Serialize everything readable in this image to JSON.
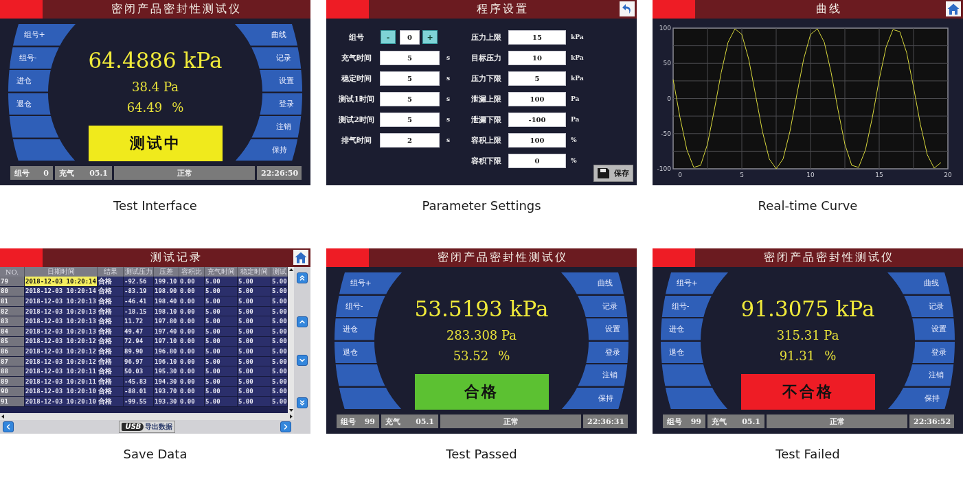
{
  "screens": [
    {
      "kind": "test",
      "title": "密闭产品密封性测试仪",
      "left_buttons": [
        "组号+",
        "组号-",
        "进仓",
        "退仓"
      ],
      "right_buttons": [
        "曲线",
        "记录",
        "设置",
        "登录",
        "注销",
        "保持"
      ],
      "pressure": "64.4886 kPa",
      "difference": "38.4 Pa",
      "ratio": "64.49",
      "ratio_unit": "%",
      "result": {
        "label": "测试中",
        "color": "#f0ea1c"
      },
      "status_bar": {
        "group_label": "组号",
        "group": "0",
        "fill_label": "充气",
        "fill": "05.1",
        "state": "正常",
        "time": "22:26:50"
      },
      "caption": "Test Interface"
    },
    {
      "kind": "settings",
      "title": "程序设置",
      "group": {
        "label": "组号",
        "minus": "-",
        "value": "0",
        "plus": "+"
      },
      "left_fields": [
        {
          "label": "充气时间",
          "value": "5",
          "unit": "s"
        },
        {
          "label": "稳定时间",
          "value": "5",
          "unit": "s"
        },
        {
          "label": "测试1时间",
          "value": "5",
          "unit": "s"
        },
        {
          "label": "测试2时间",
          "value": "5",
          "unit": "s"
        },
        {
          "label": "排气时间",
          "value": "2",
          "unit": "s"
        }
      ],
      "right_fields": [
        {
          "label": "压力上限",
          "value": "15",
          "unit": "kPa"
        },
        {
          "label": "目标压力",
          "value": "10",
          "unit": "kPa"
        },
        {
          "label": "压力下限",
          "value": "5",
          "unit": "kPa"
        },
        {
          "label": "泄漏上限",
          "value": "100",
          "unit": "Pa"
        },
        {
          "label": "泄漏下限",
          "value": "-100",
          "unit": "Pa"
        },
        {
          "label": "容积上限",
          "value": "100",
          "unit": "%"
        },
        {
          "label": "容积下限",
          "value": "0",
          "unit": "%"
        }
      ],
      "save": "保存",
      "caption": "Parameter Settings"
    },
    {
      "kind": "curve",
      "title": "曲线",
      "chart_data": {
        "type": "line",
        "x": [
          0,
          0.5,
          1,
          1.5,
          2,
          2.5,
          3,
          3.5,
          4,
          4.5,
          5,
          5.5,
          6,
          6.5,
          7,
          7.5,
          8,
          8.5,
          9,
          9.5,
          10,
          10.5,
          11,
          11.5,
          12,
          12.5,
          13,
          13.5,
          14,
          14.5,
          15,
          15.5,
          16,
          16.5,
          17,
          17.5,
          18,
          18.5,
          19,
          19.5
        ],
        "series": [
          {
            "color": "#d8d83c",
            "values": [
              27,
              -27,
              -73,
              -98,
              -95,
              -65,
              -16,
              37,
              80,
              99,
              91,
              56,
              5,
              -47,
              -86,
              -100,
              -86,
              -47,
              5,
              56,
              91,
              99,
              80,
              37,
              -16,
              -65,
              -95,
              -98,
              -73,
              -27,
              27,
              73,
              98,
              95,
              65,
              16,
              -37,
              -80,
              -99,
              -91
            ]
          }
        ],
        "xlim": [
          0,
          20
        ],
        "ylim": [
          -100,
          100
        ],
        "grid": true,
        "xticks": [
          0,
          5,
          10,
          15,
          20
        ],
        "yticks": [
          -100,
          -50,
          0,
          50,
          100
        ]
      },
      "caption": "Real-time Curve"
    },
    {
      "kind": "records",
      "title": "测试记录",
      "columns": [
        "NO.",
        "日期时间",
        "结果",
        "测试压力",
        "压差",
        "容积比",
        "充气时间",
        "稳定时间",
        "测试"
      ],
      "rows": [
        {
          "cells": [
            "79",
            "2018-12-03 10:20:14",
            "合格",
            "-92.56",
            "199.10",
            "0.00",
            "5.00",
            "5.00",
            "5.00"
          ],
          "selected": true
        },
        {
          "cells": [
            "80",
            "2018-12-03 10:20:14",
            "合格",
            "-83.19",
            "198.90",
            "0.00",
            "5.00",
            "5.00",
            "5.00"
          ],
          "selected": false
        },
        {
          "cells": [
            "81",
            "2018-12-03 10:20:13",
            "合格",
            "-46.41",
            "198.40",
            "0.00",
            "5.00",
            "5.00",
            "5.00"
          ],
          "selected": false
        },
        {
          "cells": [
            "82",
            "2018-12-03 10:20:13",
            "合格",
            "-18.15",
            "198.10",
            "0.00",
            "5.00",
            "5.00",
            "5.00"
          ],
          "selected": false
        },
        {
          "cells": [
            "83",
            "2018-12-03 10:20:13",
            "合格",
            "11.72",
            "197.80",
            "0.00",
            "5.00",
            "5.00",
            "5.00"
          ],
          "selected": false
        },
        {
          "cells": [
            "84",
            "2018-12-03 10:20:13",
            "合格",
            "49.47",
            "197.40",
            "0.00",
            "5.00",
            "5.00",
            "5.00"
          ],
          "selected": false
        },
        {
          "cells": [
            "85",
            "2018-12-03 10:20:12",
            "合格",
            "72.94",
            "197.10",
            "0.00",
            "5.00",
            "5.00",
            "5.00"
          ],
          "selected": false
        },
        {
          "cells": [
            "86",
            "2018-12-03 10:20:12",
            "合格",
            "89.90",
            "196.80",
            "0.00",
            "5.00",
            "5.00",
            "5.00"
          ],
          "selected": false
        },
        {
          "cells": [
            "87",
            "2018-12-03 10:20:12",
            "合格",
            "96.97",
            "196.10",
            "0.00",
            "5.00",
            "5.00",
            "5.00"
          ],
          "selected": false
        },
        {
          "cells": [
            "88",
            "2018-12-03 10:20:11",
            "合格",
            "50.03",
            "195.30",
            "0.00",
            "5.00",
            "5.00",
            "5.00"
          ],
          "selected": false
        },
        {
          "cells": [
            "89",
            "2018-12-03 10:20:11",
            "合格",
            "-45.83",
            "194.30",
            "0.00",
            "5.00",
            "5.00",
            "5.00"
          ],
          "selected": false
        },
        {
          "cells": [
            "90",
            "2018-12-03 10:20:10",
            "合格",
            "-88.01",
            "193.70",
            "0.00",
            "5.00",
            "5.00",
            "5.00"
          ],
          "selected": false
        },
        {
          "cells": [
            "91",
            "2018-12-03 10:20:10",
            "合格",
            "-99.55",
            "193.30",
            "0.00",
            "5.00",
            "5.00",
            "5.00"
          ],
          "selected": false
        }
      ],
      "usb_logo": "USB",
      "export": "导出数据",
      "caption": "Save Data"
    },
    {
      "kind": "test",
      "title": "密闭产品密封性测试仪",
      "left_buttons": [
        "组号+",
        "组号-",
        "进仓",
        "退仓"
      ],
      "right_buttons": [
        "曲线",
        "记录",
        "设置",
        "登录",
        "注销",
        "保持"
      ],
      "pressure": "53.5193 kPa",
      "difference": "283.308 Pa",
      "ratio": "53.52",
      "ratio_unit": "%",
      "result": {
        "label": "合格",
        "color": "#5cc132"
      },
      "status_bar": {
        "group_label": "组号",
        "group": "99",
        "fill_label": "充气",
        "fill": "05.1",
        "state": "正常",
        "time": "22:36:31"
      },
      "caption": "Test Passed"
    },
    {
      "kind": "test",
      "title": "密闭产品密封性测试仪",
      "left_buttons": [
        "组号+",
        "组号-",
        "进仓",
        "退仓"
      ],
      "right_buttons": [
        "曲线",
        "记录",
        "设置",
        "登录",
        "注销",
        "保持"
      ],
      "pressure": "91.3075 kPa",
      "difference": "315.31 Pa",
      "ratio": "91.31",
      "ratio_unit": "%",
      "result": {
        "label": "不合格",
        "color": "#ee1c25"
      },
      "status_bar": {
        "group_label": "组号",
        "group": "99",
        "fill_label": "充气",
        "fill": "05.1",
        "state": "正常",
        "time": "22:36:52"
      },
      "caption": "Test Failed"
    }
  ]
}
